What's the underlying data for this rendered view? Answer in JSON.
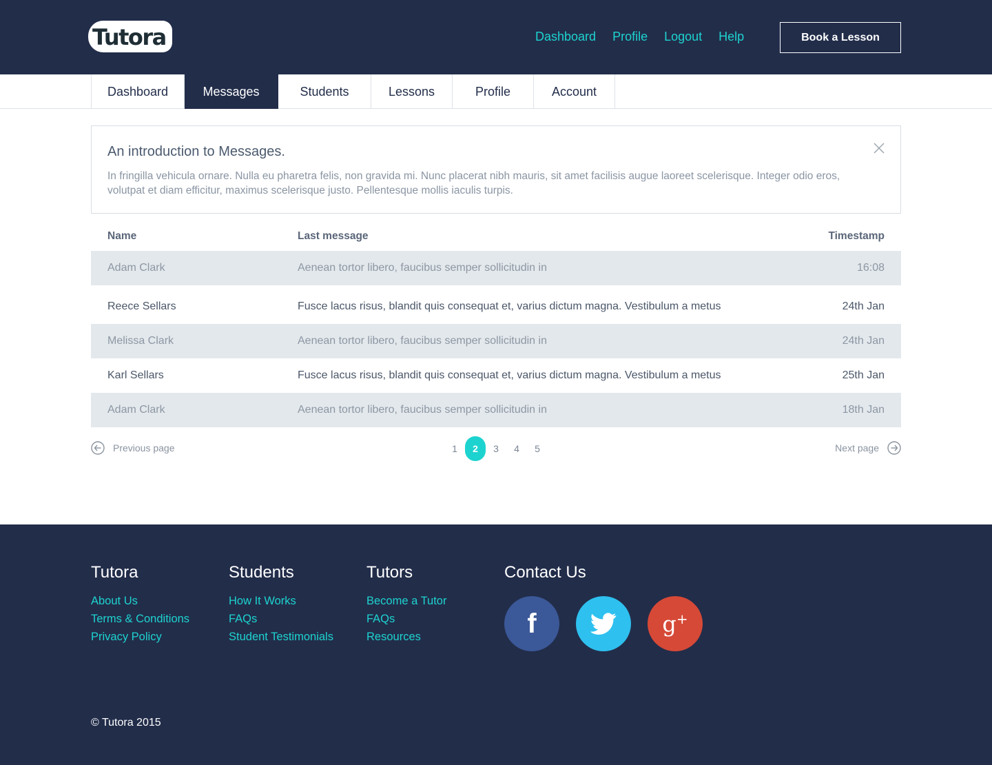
{
  "header": {
    "logo": "Tutora",
    "nav": [
      "Dashboard",
      "Profile",
      "Logout",
      "Help"
    ],
    "book_button": "Book a Lesson"
  },
  "tabs": [
    {
      "label": "Dashboard",
      "active": false
    },
    {
      "label": "Messages",
      "active": true
    },
    {
      "label": "Students",
      "active": false
    },
    {
      "label": "Lessons",
      "active": false
    },
    {
      "label": "Profile",
      "active": false
    },
    {
      "label": "Account",
      "active": false
    }
  ],
  "intro": {
    "title": "An introduction to Messages.",
    "body": "In fringilla vehicula ornare. Nulla eu pharetra felis, non gravida mi. Nunc placerat nibh mauris, sit amet facilisis augue laoreet scelerisque. Integer odio eros, volutpat et diam efficitur, maximus scelerisque justo. Pellentesque mollis iaculis turpis."
  },
  "table": {
    "headers": {
      "name": "Name",
      "message": "Last message",
      "timestamp": "Timestamp"
    },
    "rows": [
      {
        "name": "Adam Clark",
        "message": "Aenean tortor libero, faucibus semper sollicitudin in",
        "timestamp": "16:08"
      },
      {
        "name": "Reece Sellars",
        "message": "Fusce lacus risus, blandit quis consequat et, varius dictum magna. Vestibulum a metus",
        "timestamp": "24th Jan"
      },
      {
        "name": "Melissa Clark",
        "message": "Aenean tortor libero, faucibus semper sollicitudin in",
        "timestamp": "24th Jan"
      },
      {
        "name": "Karl Sellars",
        "message": "Fusce lacus risus, blandit quis consequat et, varius dictum magna. Vestibulum a metus",
        "timestamp": "25th Jan"
      },
      {
        "name": "Adam Clark",
        "message": "Aenean tortor libero, faucibus semper sollicitudin in",
        "timestamp": "18th Jan"
      }
    ]
  },
  "pagination": {
    "previous": "Previous page",
    "next": "Next page",
    "pages": [
      "1",
      "2",
      "3",
      "4",
      "5"
    ],
    "current": "2"
  },
  "footer": {
    "tutora": {
      "title": "Tutora",
      "links": [
        "About Us",
        "Terms & Conditions",
        "Privacy Policy"
      ]
    },
    "students": {
      "title": "Students",
      "links": [
        "How It Works",
        "FAQs",
        "Student Testimonials"
      ]
    },
    "tutors": {
      "title": "Tutors",
      "links": [
        "Become a Tutor",
        "FAQs",
        "Resources"
      ]
    },
    "contact": {
      "title": "Contact Us",
      "social": [
        "facebook-icon",
        "twitter-icon",
        "google-plus-icon"
      ]
    },
    "copyright": "© Tutora 2015"
  },
  "colors": {
    "navy": "#222d4a",
    "accent": "#1dd3cf",
    "row_shade": "#e3e8ec",
    "facebook": "#3b5898",
    "twitter": "#2ec0ef",
    "google_plus": "#d64937"
  }
}
